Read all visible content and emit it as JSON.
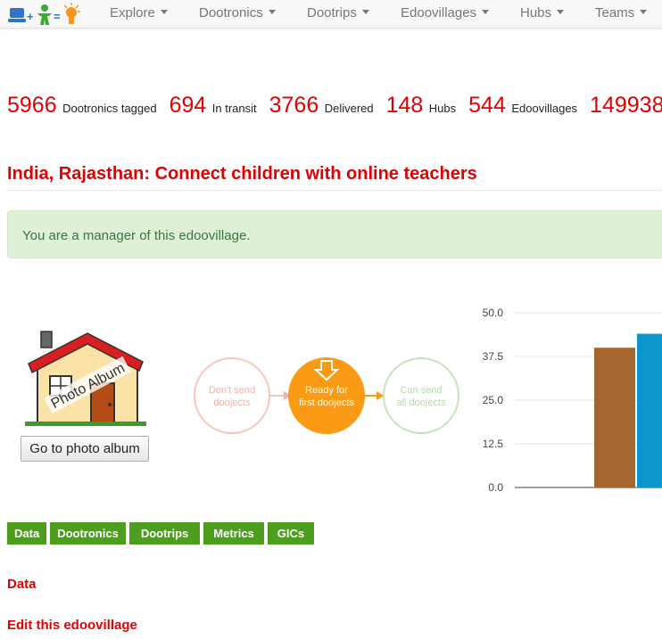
{
  "nav": {
    "items": [
      {
        "label": "Explore"
      },
      {
        "label": "Dootronics"
      },
      {
        "label": "Dootrips"
      },
      {
        "label": "Edoovillages"
      },
      {
        "label": "Hubs"
      },
      {
        "label": "Teams"
      }
    ]
  },
  "stats": [
    {
      "value": "5966",
      "label": "Dootronics tagged"
    },
    {
      "value": "694",
      "label": "In transit"
    },
    {
      "value": "3766",
      "label": "Delivered"
    },
    {
      "value": "148",
      "label": "Hubs"
    },
    {
      "value": "544",
      "label": "Edoovillages"
    },
    {
      "value": "149938",
      "label": ""
    }
  ],
  "page": {
    "title": "India, Rajasthan: Connect children with online teachers"
  },
  "alert": {
    "text": "You are a manager of this edoovillage."
  },
  "photo_album": {
    "image_text": "Photo Album",
    "button_label": "Go to photo album"
  },
  "stages": {
    "items": [
      {
        "line1": "Don't send",
        "line2": "doojects",
        "state": "inactive"
      },
      {
        "line1": "Ready for",
        "line2": "first doojects",
        "state": "active"
      },
      {
        "line1": "Can send",
        "line2": "all doojects",
        "state": "inactive"
      }
    ],
    "colors": {
      "first": "#f6b8aa",
      "active": "#fb9a14",
      "third": "#b6dca6"
    }
  },
  "chart_data": {
    "type": "bar",
    "y_ticks": [
      "50.0",
      "37.5",
      "25.0",
      "12.5",
      "0.0"
    ],
    "ylim": [
      0,
      50
    ],
    "series": [
      {
        "values": [
          40
        ],
        "color": "#a5652e"
      },
      {
        "values": [
          44
        ],
        "color": "#0b95c8"
      }
    ],
    "grid": true
  },
  "tabs": [
    {
      "label": "Data"
    },
    {
      "label": "Dootronics"
    },
    {
      "label": "Dootrips"
    },
    {
      "label": "Metrics"
    },
    {
      "label": "GICs"
    }
  ],
  "links": {
    "data": "Data",
    "edit": "Edit this edoovillage"
  }
}
